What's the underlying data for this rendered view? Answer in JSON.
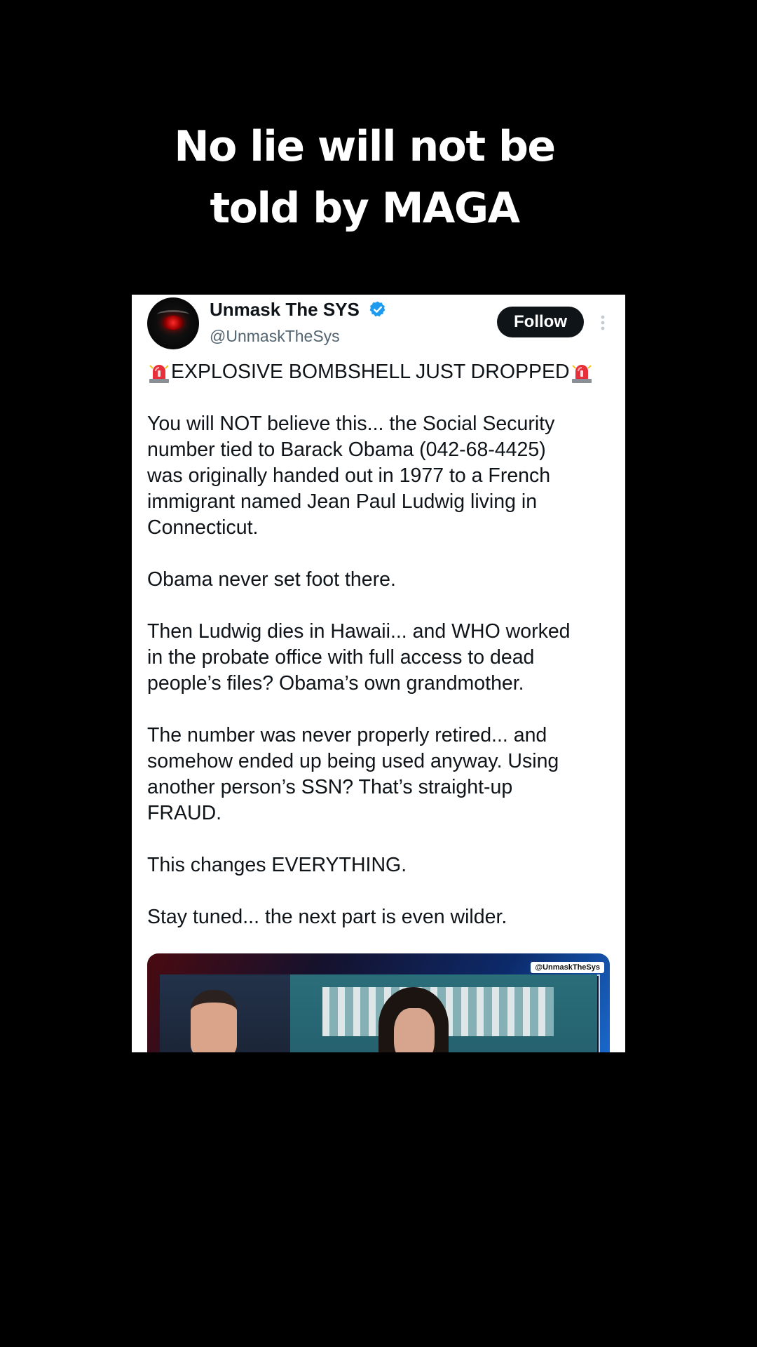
{
  "caption": {
    "line1": "No lie will not be",
    "line2": "told by MAGA"
  },
  "tweet": {
    "display_name": "Unmask The SYS",
    "handle": "@UnmaskTheSys",
    "follow_label": "Follow",
    "headline": "EXPLOSIVE BOMBSHELL JUST DROPPED",
    "paragraphs": [
      "You will NOT believe this... the Social Security\nnumber tied to Barack Obama (042-68-4425)\nwas originally handed out in 1977 to a French\nimmigrant named Jean Paul Ludwig living in\nConnecticut.",
      "Obama never set foot there.",
      "Then Ludwig dies in Hawaii... and WHO worked\nin the probate office with full access to dead\npeople’s files? Obama’s own grandmother.",
      "The number was never properly retired... and\nsomehow ended up being used anyway. Using\nanother person’s SSN? That’s straight-up\nFRAUD.",
      "This changes EVERYTHING.",
      "Stay tuned... the next part is even wilder."
    ],
    "media_watermark": "@UnmaskTheSys"
  },
  "icons": {
    "verified": "verified-badge-icon",
    "more": "more-vertical-icon",
    "siren": "police-siren-icon"
  },
  "colors": {
    "background": "#000000",
    "card": "#ffffff",
    "text": "#0f1419",
    "muted": "#536471",
    "verified": "#1d9bf0",
    "follow_button": "#0f1419"
  }
}
